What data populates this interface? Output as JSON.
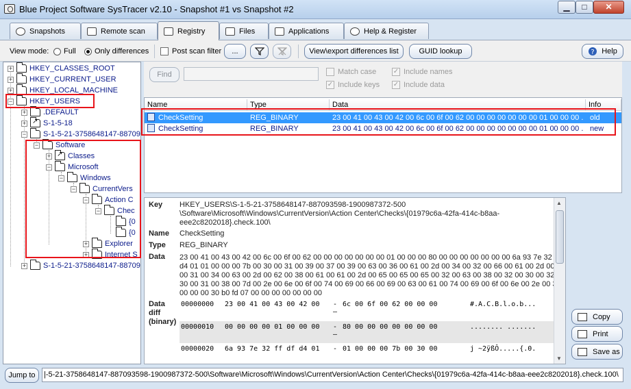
{
  "window": {
    "title": "Blue Project Software SysTracer v2.10 - Snapshot #1 vs Snapshot #2",
    "minimize": "▁",
    "maximize": "□",
    "close": "✕"
  },
  "tabs": [
    {
      "label": "Snapshots",
      "icon": "camera-icon"
    },
    {
      "label": "Remote scan",
      "icon": "remote-scan-icon"
    },
    {
      "label": "Registry",
      "icon": "registry-icon",
      "active": true
    },
    {
      "label": "Files",
      "icon": "files-icon"
    },
    {
      "label": "Applications",
      "icon": "applications-icon"
    },
    {
      "label": "Help & Register",
      "icon": "help-register-icon"
    }
  ],
  "toolbar": {
    "view_mode_label": "View mode:",
    "full_label": "Full",
    "only_differences_label": "Only differences",
    "only_differences_selected": true,
    "post_scan_filter_label": "Post scan filter",
    "post_scan_filter_checked": false,
    "more_label": "...",
    "filter_icon": "filter-icon",
    "clear_filter_icon": "clear-filter-icon",
    "export_label": "View\\export differences list",
    "guid_label": "GUID lookup",
    "help_label": "Help"
  },
  "tree": {
    "items": [
      {
        "label": "HKEY_CLASSES_ROOT"
      },
      {
        "label": "HKEY_CURRENT_USER"
      },
      {
        "label": "HKEY_LOCAL_MACHINE"
      },
      {
        "label": "HKEY_USERS"
      },
      {
        "label": ".DEFAULT"
      },
      {
        "label": "S-1-5-18"
      },
      {
        "label": "S-1-5-21-3758648147-88709"
      },
      {
        "label": "Software"
      },
      {
        "label": "Classes"
      },
      {
        "label": "Microsoft"
      },
      {
        "label": "Windows"
      },
      {
        "label": "CurrentVers"
      },
      {
        "label": "Action C"
      },
      {
        "label": "Chec"
      },
      {
        "label": "{0"
      },
      {
        "label": "{0"
      },
      {
        "label": "Explorer"
      },
      {
        "label": "Internet S"
      },
      {
        "label": "S-1-5-21-3758648147-88709"
      }
    ]
  },
  "find": {
    "button_label": "Find",
    "input_value": "",
    "match_case_label": "Match case",
    "match_case_checked": false,
    "include_names_label": "Include names",
    "include_names_checked": true,
    "include_keys_label": "Include keys",
    "include_keys_checked": true,
    "include_data_label": "Include data",
    "include_data_checked": true
  },
  "list": {
    "columns": [
      "Name",
      "Type",
      "Data",
      "Info"
    ],
    "rows": [
      {
        "name": "CheckSetting",
        "type": "REG_BINARY",
        "data": "23 00 41 00 43 00 42 00 6c 00 6f 00 62 00 00 00 00 00 00 00 01 00 00 00 ...",
        "info": "old",
        "selected": true
      },
      {
        "name": "CheckSetting",
        "type": "REG_BINARY",
        "data": "23 00 41 00 43 00 42 00 6c 00 6f 00 62 00 00 00 00 00 00 00 01 00 00 00 ...",
        "info": "new",
        "selected": false
      }
    ]
  },
  "details": {
    "key_label": "Key",
    "key_lines": [
      "HKEY_USERS\\S-1-5-21-3758648147-887093598-1900987372-500",
      "\\Software\\Microsoft\\Windows\\CurrentVersion\\Action Center\\Checks\\{01979c6a-42fa-414c-b8aa-",
      "eee2c8202018}.check.100\\"
    ],
    "name_label": "Name",
    "name_value": "CheckSetting",
    "type_label": "Type",
    "type_value": "REG_BINARY",
    "data_label": "Data",
    "data_lines": [
      "23 00 41 00 43 00 42 00 6c 00 6f 00 62 00 00 00 00 00 00 00 01 00 00 00 80 00 00 00 00 00 00 00 6a 93 7e 32 ff",
      "d4 01 01 00 00 00 7b 00 30 00 31 00 39 00 37 00 39 00 63 00 36 00 61 00 2d 00 34 00 32 00 66 00 61 00 2d 00 3",
      "00 31 00 34 00 63 00 2d 00 62 00 38 00 61 00 61 00 2d 00 65 00 65 00 65 00 32 00 63 00 38 00 32 00 30 00 32 0",
      "30 00 31 00 38 00 7d 00 2e 00 6e 00 6f 00 74 00 69 00 66 00 69 00 63 00 61 00 74 00 69 00 6f 00 6e 00 2e 00 30",
      "00 00 00 30 b0 fd 07 00 00 00 00 00 00 00"
    ],
    "diff_label_1": "Data",
    "diff_label_2": "diff",
    "diff_label_3": "(binary)",
    "hex_rows": [
      {
        "offset": "00000000",
        "bytes1": "23 00 41 00 43 00 42 00",
        "dash": "-",
        "bytes2": "6c 00 6f 00 62 00 00 00",
        "ascii": "#.A.C.B.l.o.b...",
        "underscore": "–"
      },
      {
        "offset": "00000010",
        "bytes1": "00 00 00 00 01 00 00 00",
        "dash": "-",
        "bytes2": "80 00 00 00 00 00 00 00",
        "ascii": "........ .......",
        "underscore": "–"
      },
      {
        "offset": "00000020",
        "bytes1": "6a 93 7e 32 ff df d4 01",
        "dash": "-",
        "bytes2": "01 00 00 00 7b 00 30 00",
        "ascii": "j ~2ÿßÔ.....{.0.",
        "underscore": ""
      }
    ]
  },
  "side_buttons": {
    "copy_label": "Copy",
    "print_label": "Print",
    "save_as_label": "Save as"
  },
  "bottom": {
    "jump_label": "Jump to",
    "path_value": "|-5-21-3758648147-887093598-1900987372-500\\Software\\Microsoft\\Windows\\CurrentVersion\\Action Center\\Checks\\{01979c6a-42fa-414c-b8aa-eee2c8202018}.check.100\\"
  },
  "colors": {
    "annotation_red": "#e8141a",
    "selection_blue": "#3399ff",
    "tree_text": "#0a1a8a"
  }
}
